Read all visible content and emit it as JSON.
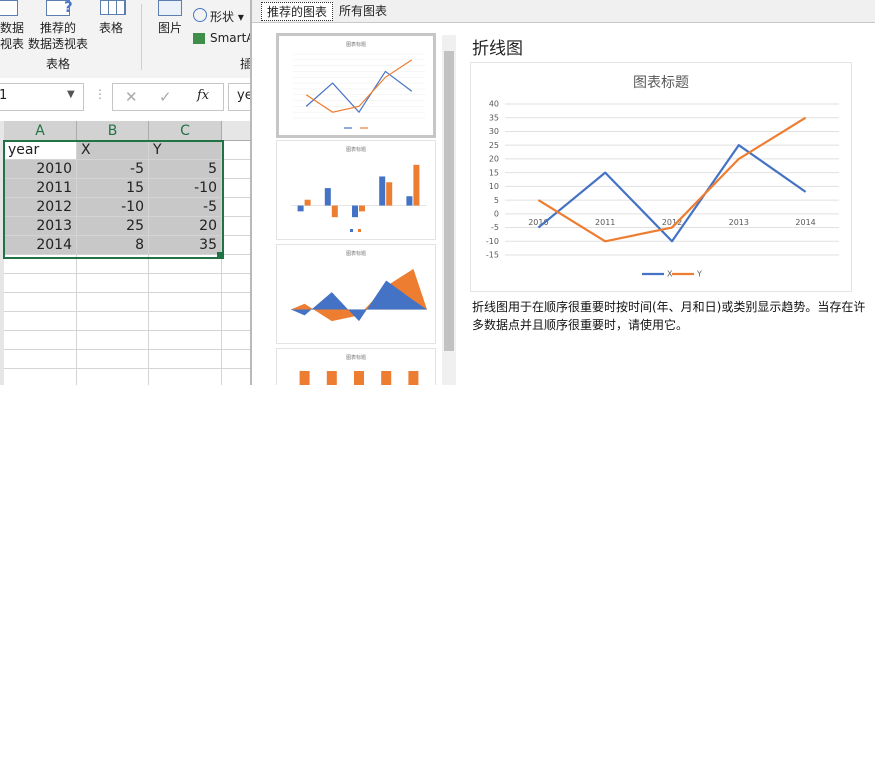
{
  "ribbon": {
    "pivot_partial_label_1": "数据",
    "pivot_partial_label_2": "视表",
    "recommended_pivot_label_1": "推荐的",
    "recommended_pivot_label_2": "数据透视表",
    "table_label": "表格",
    "group_tables": "表格",
    "picture_label": "图片",
    "shapes_label": "形状 ▾",
    "smartart_label": "SmartA",
    "group_insert_partial": "插"
  },
  "formula_bar": {
    "name_box": "1",
    "cancel_glyph": "✕",
    "enter_glyph": "✓",
    "fx_glyph": "fx",
    "formula_partial": "ye"
  },
  "sheet": {
    "col_headers": [
      "A",
      "B",
      "C"
    ],
    "rows": [
      [
        "year",
        "X",
        "Y"
      ],
      [
        "2010",
        "-5",
        "5"
      ],
      [
        "2011",
        "15",
        "-10"
      ],
      [
        "2012",
        "-10",
        "-5"
      ],
      [
        "2013",
        "25",
        "20"
      ],
      [
        "2014",
        "8",
        "35"
      ]
    ]
  },
  "dialog": {
    "tabs": [
      "推荐的图表",
      "所有图表"
    ],
    "chart_type_title": "折线图",
    "description": "折线图用于在顺序很重要时按时间(年、月和日)或类别显示趋势。当存在许多数据点并且顺序很重要时，请使用它。",
    "thumbnail_title": "图表标题"
  },
  "colors": {
    "x": "#4472c4",
    "y": "#ed7d31",
    "excel_green": "#217346"
  },
  "chart_data": {
    "type": "line",
    "title": "图表标题",
    "categories": [
      "2010",
      "2011",
      "2012",
      "2013",
      "2014"
    ],
    "series": [
      {
        "name": "X",
        "values": [
          -5,
          15,
          -10,
          25,
          8
        ]
      },
      {
        "name": "Y",
        "values": [
          5,
          -10,
          -5,
          20,
          35
        ]
      }
    ],
    "ylim": [
      -15,
      40
    ],
    "yticks": [
      "40",
      "35",
      "30",
      "25",
      "20",
      "15",
      "10",
      "5",
      "0",
      "-5",
      "-10",
      "-15"
    ],
    "grid": true,
    "legend": "bottom"
  }
}
